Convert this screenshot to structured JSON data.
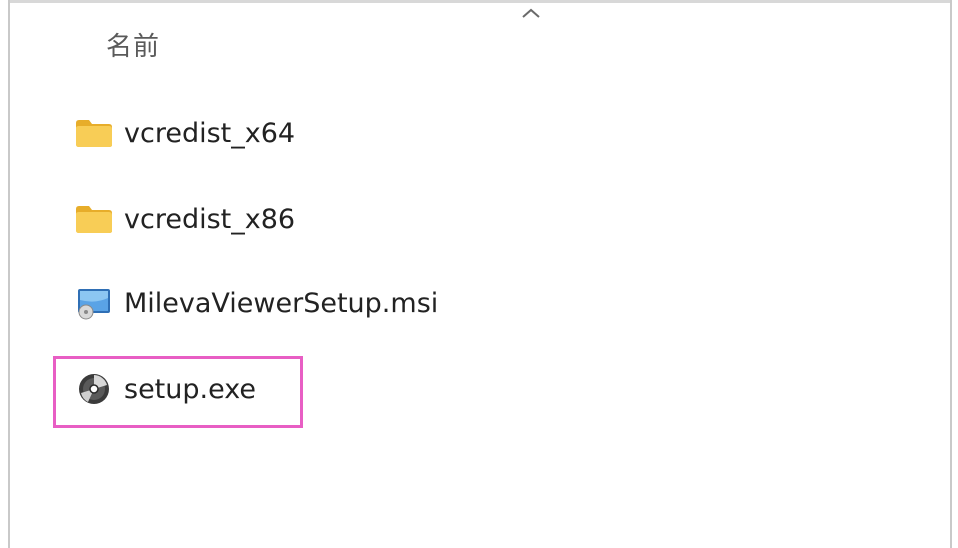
{
  "header": {
    "column_name": "名前"
  },
  "files": [
    {
      "name": "vcredist_x64",
      "icon": "folder-icon"
    },
    {
      "name": "vcredist_x86",
      "icon": "folder-icon"
    },
    {
      "name": "MilevaViewerSetup.msi",
      "icon": "msi-installer-icon"
    },
    {
      "name": "setup.exe",
      "icon": "setup-disc-icon"
    }
  ],
  "colors": {
    "highlight_border": "#e85ec4",
    "folder": "#f7c64a"
  }
}
